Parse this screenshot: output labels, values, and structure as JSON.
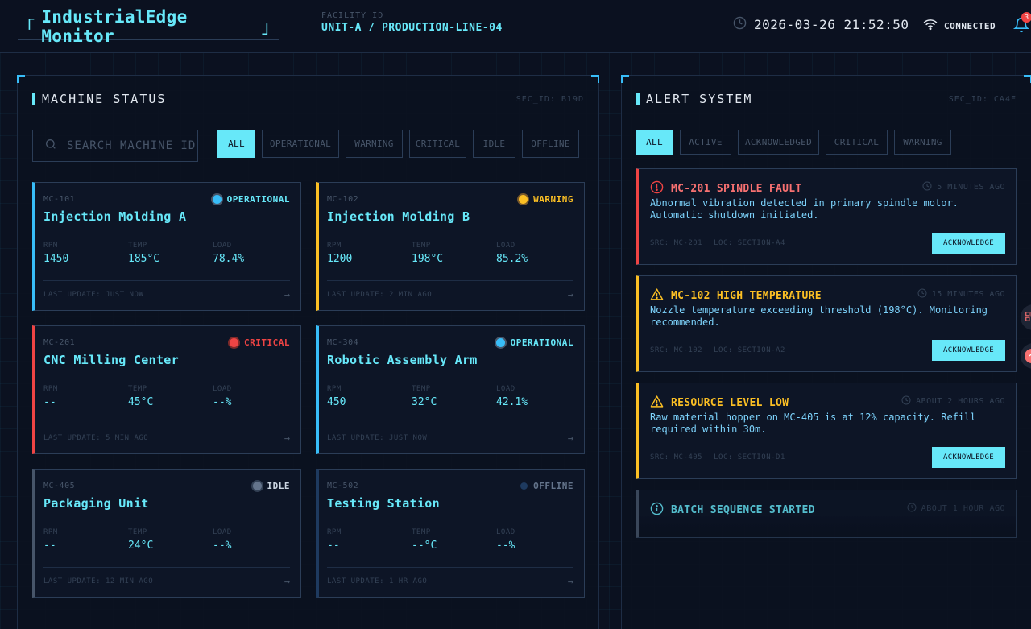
{
  "header": {
    "bracket_open": "「",
    "title": "IndustrialEdge Monitor",
    "bracket_close": "」",
    "facility_label": "FACILITY ID",
    "facility_value": "UNIT-A / PRODUCTION-LINE-04",
    "datetime": "2026-03-26 21:52:50",
    "connection": "CONNECTED",
    "notification_count": "3"
  },
  "machines": {
    "title": "MACHINE STATUS",
    "sec_id": "SEC_ID: B19D",
    "search_placeholder": "SEARCH MACHINE ID",
    "filters": [
      "ALL",
      "OPERATIONAL",
      "WARNING",
      "CRITICAL",
      "IDLE",
      "OFFLINE"
    ],
    "active_filter": "ALL",
    "metric_labels": {
      "rpm": "RPM",
      "temp": "TEMP",
      "load": "LOAD"
    },
    "cards": [
      {
        "id": "MC-101",
        "name": "Injection Molding A",
        "status": "OPERATIONAL",
        "rpm": "1450",
        "temp": "185°C",
        "load": "78.4%",
        "last_update": "LAST UPDATE: JUST NOW"
      },
      {
        "id": "MC-102",
        "name": "Injection Molding B",
        "status": "WARNING",
        "rpm": "1200",
        "temp": "198°C",
        "load": "85.2%",
        "last_update": "LAST UPDATE: 2 MIN AGO"
      },
      {
        "id": "MC-201",
        "name": "CNC Milling Center",
        "status": "CRITICAL",
        "rpm": "--",
        "temp": "45°C",
        "load": "--%",
        "last_update": "LAST UPDATE: 5 MIN AGO"
      },
      {
        "id": "MC-304",
        "name": "Robotic Assembly Arm",
        "status": "OPERATIONAL",
        "rpm": "450",
        "temp": "32°C",
        "load": "42.1%",
        "last_update": "LAST UPDATE: JUST NOW"
      },
      {
        "id": "MC-405",
        "name": "Packaging Unit",
        "status": "IDLE",
        "rpm": "--",
        "temp": "24°C",
        "load": "--%",
        "last_update": "LAST UPDATE: 12 MIN AGO"
      },
      {
        "id": "MC-502",
        "name": "Testing Station",
        "status": "OFFLINE",
        "rpm": "--",
        "temp": "--°C",
        "load": "--%",
        "last_update": "LAST UPDATE: 1 HR AGO"
      }
    ]
  },
  "alerts": {
    "title": "ALERT SYSTEM",
    "sec_id": "SEC_ID: CA4E",
    "filters": [
      "ALL",
      "ACTIVE",
      "ACKNOWLEDGED",
      "CRITICAL",
      "WARNING"
    ],
    "active_filter": "ALL",
    "ack_label": "ACKNOWLEDGE",
    "items": [
      {
        "title": "MC-201 SPINDLE FAULT",
        "level": "critical",
        "icon": "alert-circle-icon",
        "time": "5 MINUTES AGO",
        "description": "Abnormal vibration detected in primary spindle motor. Automatic shutdown initiated.",
        "src": "SRC: MC-201",
        "loc": "LOC: SECTION-A4"
      },
      {
        "title": "MC-102 HIGH TEMPERATURE",
        "level": "warning",
        "icon": "warning-triangle-icon",
        "time": "15 MINUTES AGO",
        "description": "Nozzle temperature exceeding threshold (198°C). Monitoring recommended.",
        "src": "SRC: MC-102",
        "loc": "LOC: SECTION-A2"
      },
      {
        "title": "RESOURCE LEVEL LOW",
        "level": "warning",
        "icon": "warning-triangle-icon",
        "time": "ABOUT 2 HOURS AGO",
        "description": "Raw material hopper on MC-405 is at 12% capacity. Refill required within 30m.",
        "src": "SRC: MC-405",
        "loc": "LOC: SECTION-D1"
      },
      {
        "title": "BATCH SEQUENCE STARTED",
        "level": "info",
        "icon": "info-circle-icon",
        "time": "ABOUT 1 HOUR AGO"
      }
    ]
  },
  "colors": {
    "background": "#0b1120",
    "accent": "#67e8f9",
    "operational": "#38bdf8",
    "warning": "#fbbf24",
    "critical": "#ef4444",
    "idle": "#64748b",
    "offline": "#1e3a5f"
  }
}
